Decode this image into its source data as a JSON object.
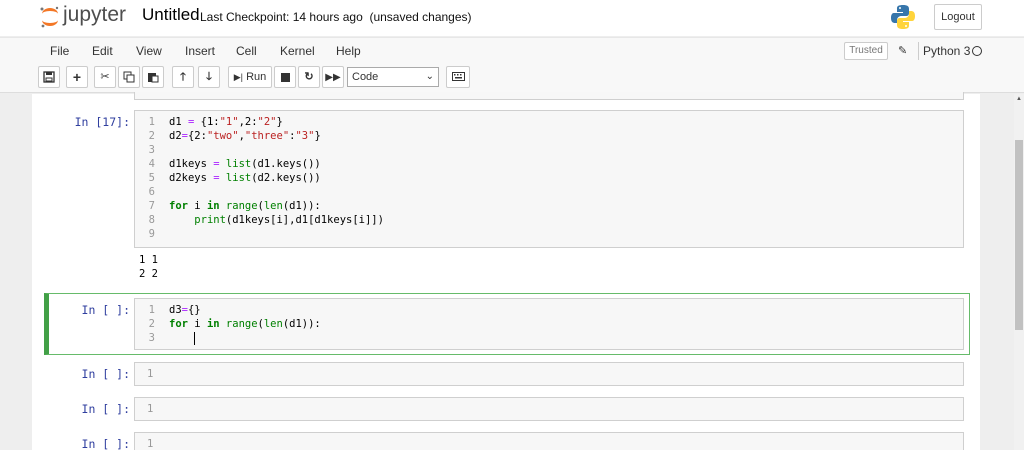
{
  "header": {
    "logo_text": "jupyter",
    "notebook_name": "Untitled",
    "checkpoint": "Last Checkpoint: 14 hours ago",
    "unsaved": "(unsaved changes)",
    "logout_label": "Logout"
  },
  "menubar": {
    "items": [
      "File",
      "Edit",
      "View",
      "Insert",
      "Cell",
      "Kernel",
      "Help"
    ],
    "trusted": "Trusted",
    "kernel_name": "Python 3"
  },
  "toolbar": {
    "run_label": "Run",
    "cell_type": "Code"
  },
  "cells": [
    {
      "prompt": "In [17]:",
      "lines": [
        "d1 = {1:\"1\",2:\"2\"}",
        "d2={2:\"two\",\"three\":\"3\"}",
        "",
        "d1keys = list(d1.keys())",
        "d2keys = list(d2.keys())",
        "",
        "for i in range(len(d1)):",
        "    print(d1keys[i],d1[d1keys[i]])",
        ""
      ],
      "output": [
        "1 1",
        "2 2"
      ]
    },
    {
      "prompt": "In [ ]:",
      "lines": [
        "d3={}",
        "for i in range(len(d1)):",
        "    "
      ]
    },
    {
      "prompt": "In [ ]:",
      "lines": [
        ""
      ]
    },
    {
      "prompt": "In [ ]:",
      "lines": [
        ""
      ]
    },
    {
      "prompt": "In [ ]:",
      "lines": [
        ""
      ]
    }
  ],
  "line_numbers": [
    "1",
    "2",
    "3",
    "4",
    "5",
    "6",
    "7",
    "8",
    "9"
  ],
  "colors": {
    "prompt": "#303f9f",
    "keyword": "#008000",
    "string": "#ba2121",
    "active_border": "#42a047"
  }
}
